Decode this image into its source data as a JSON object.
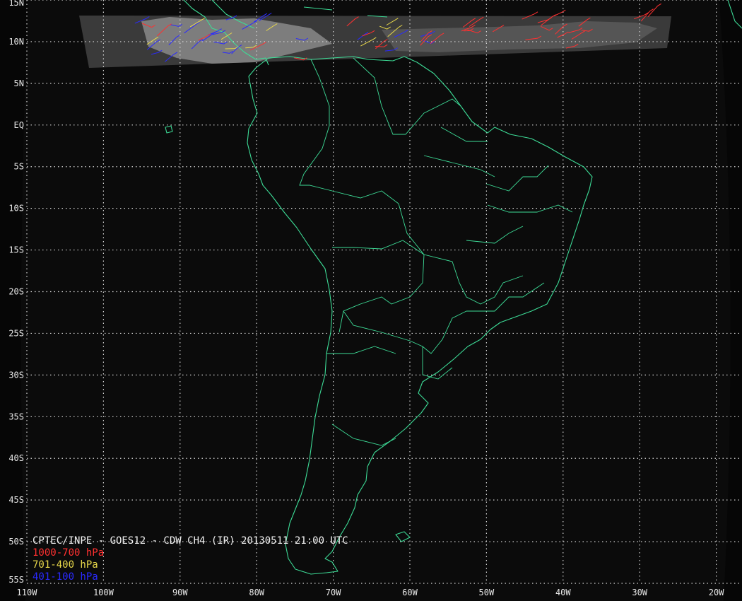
{
  "title": "CPTEC/INPE - GOES12 - CDW CH4 (IR) 20130511 21:00 UTC",
  "legend": [
    {
      "label": "1000-700 hPa",
      "color": "#ff3030"
    },
    {
      "label": "701-400 hPa",
      "color": "#e8d84a"
    },
    {
      "label": "401-100 hPa",
      "color": "#2a2aff"
    }
  ],
  "lat_labels": [
    "15N",
    "10N",
    "5N",
    "EQ",
    "5S",
    "10S",
    "15S",
    "20S",
    "25S",
    "30S",
    "35S",
    "40S",
    "45S",
    "50S",
    "55S"
  ],
  "lon_labels": [
    "110W",
    "100W",
    "90W",
    "80W",
    "70W",
    "60W",
    "50W",
    "40W",
    "30W",
    "20W"
  ],
  "colors": {
    "coastline": "#3ddc97",
    "grid": "#d8d8d8",
    "background": "#000000"
  }
}
